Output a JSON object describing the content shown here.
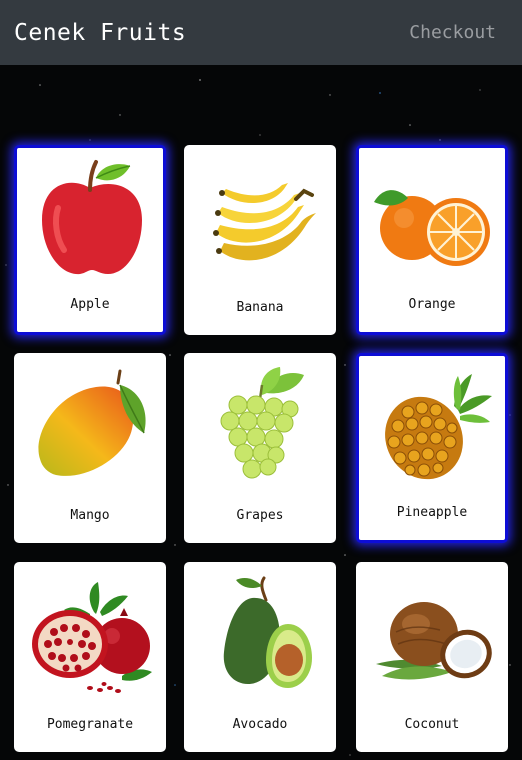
{
  "header": {
    "brand": "Cenek Fruits",
    "checkout_label": "Checkout"
  },
  "colors": {
    "selected_border": "#0d0dd6",
    "topbar": "#343a40",
    "background": "#050607"
  },
  "fruits": [
    {
      "label": "Apple",
      "icon": "apple-icon",
      "selected": true
    },
    {
      "label": "Banana",
      "icon": "banana-icon",
      "selected": false
    },
    {
      "label": "Orange",
      "icon": "orange-icon",
      "selected": true
    },
    {
      "label": "Mango",
      "icon": "mango-icon",
      "selected": false
    },
    {
      "label": "Grapes",
      "icon": "grapes-icon",
      "selected": false
    },
    {
      "label": "Pineapple",
      "icon": "pineapple-icon",
      "selected": true
    },
    {
      "label": "Pomegranate",
      "icon": "pomegranate-icon",
      "selected": false
    },
    {
      "label": "Avocado",
      "icon": "avocado-icon",
      "selected": false
    },
    {
      "label": "Coconut",
      "icon": "coconut-icon",
      "selected": false
    }
  ]
}
